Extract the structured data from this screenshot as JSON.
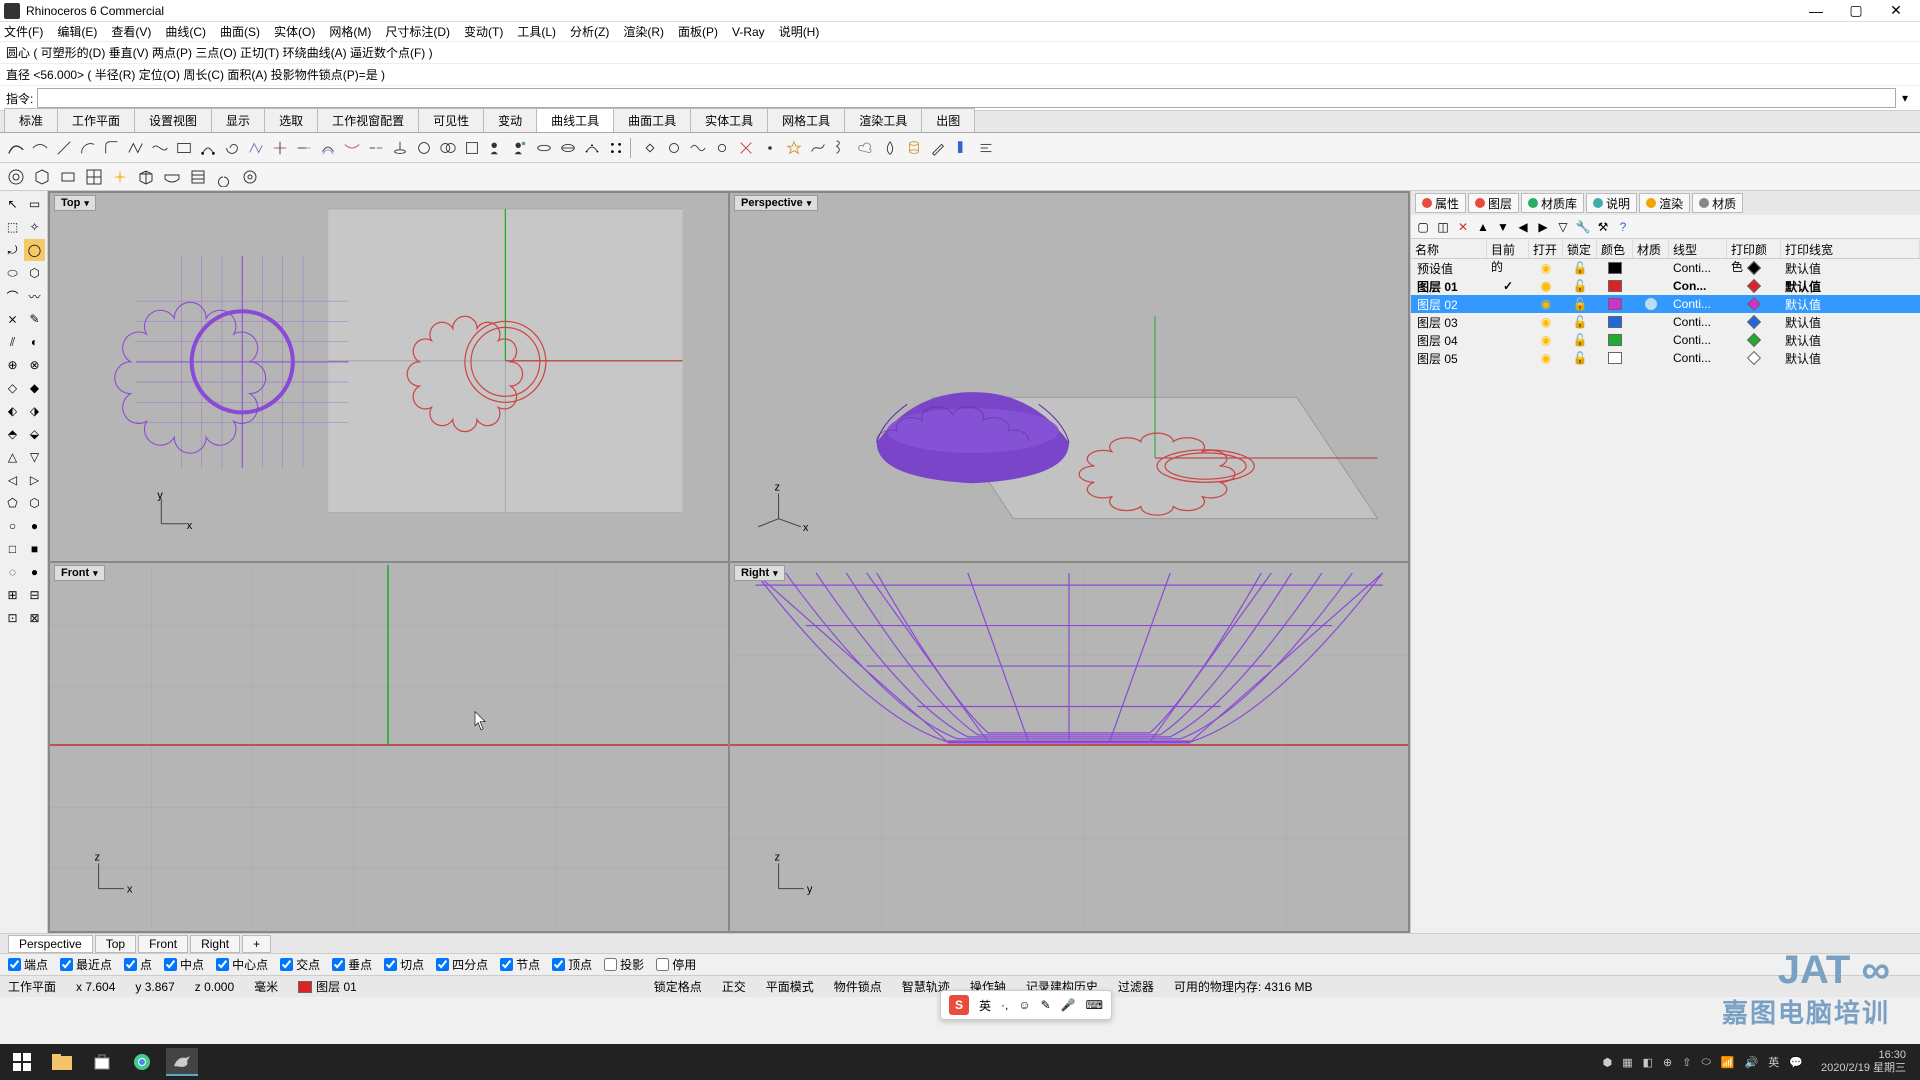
{
  "app": {
    "title": "Rhinoceros 6 Commercial"
  },
  "menu": [
    "文件(F)",
    "编辑(E)",
    "查看(V)",
    "曲线(C)",
    "曲面(S)",
    "实体(O)",
    "网格(M)",
    "尺寸标注(D)",
    "变动(T)",
    "工具(L)",
    "分析(Z)",
    "渲染(R)",
    "面板(P)",
    "V-Ray",
    "说明(H)"
  ],
  "cmd_history": [
    "圆心 ( 可塑形的(D)  垂直(V)  两点(P)  三点(O)  正切(T)  环绕曲线(A)  逼近数个点(F) )",
    "直径 <56.000> ( 半径(R)  定位(O)  周长(C)  面积(A)  投影物件锁点(P)=是 )"
  ],
  "cmd_prompt": "指令:",
  "ribbon_tabs": [
    "标准",
    "工作平面",
    "设置视图",
    "显示",
    "选取",
    "工作视窗配置",
    "可见性",
    "变动",
    "曲线工具",
    "曲面工具",
    "实体工具",
    "网格工具",
    "渲染工具",
    "出图"
  ],
  "active_ribbon_tab": 8,
  "viewports": {
    "top": "Top",
    "persp": "Perspective",
    "front": "Front",
    "right": "Right"
  },
  "bottom_vp_tabs": [
    "Perspective",
    "Top",
    "Front",
    "Right",
    "+"
  ],
  "osnaps": [
    {
      "label": "端点",
      "checked": true
    },
    {
      "label": "最近点",
      "checked": true
    },
    {
      "label": "点",
      "checked": true
    },
    {
      "label": "中点",
      "checked": true
    },
    {
      "label": "中心点",
      "checked": true
    },
    {
      "label": "交点",
      "checked": true
    },
    {
      "label": "垂点",
      "checked": true
    },
    {
      "label": "切点",
      "checked": true
    },
    {
      "label": "四分点",
      "checked": true
    },
    {
      "label": "节点",
      "checked": true
    },
    {
      "label": "顶点",
      "checked": true
    },
    {
      "label": "投影",
      "checked": false
    },
    {
      "label": "停用",
      "checked": false
    }
  ],
  "status": {
    "cplane": "工作平面",
    "x": "x 7.604",
    "y": "y 3.867",
    "z": "z 0.000",
    "unit": "毫米",
    "layer": "图层 01",
    "gridsnap": "锁定格点",
    "ortho": "正交",
    "planar": "平面模式",
    "osnap": "物件锁点",
    "smart": "智慧轨迹",
    "gumball": "操作轴",
    "history": "记录建构历史",
    "filter": "过滤器",
    "mem": "可用的物理内存: 4316 MB"
  },
  "right_panel": {
    "tabs": [
      "属性",
      "图层",
      "材质库",
      "说明",
      "渲染",
      "材质"
    ],
    "tab_colors": [
      "#e74c3c",
      "#e74c3c",
      "#27ae60",
      "#4aa",
      "#f4a300",
      "#888"
    ],
    "headers": {
      "name": "名称",
      "current": "目前的",
      "on": "打开",
      "lock": "锁定",
      "color": "颜色",
      "mat": "材质",
      "lt": "线型",
      "pc": "打印颜色",
      "pw": "打印线宽"
    },
    "layers": [
      {
        "name": "预设值",
        "current": false,
        "color": "#000000",
        "lt": "Conti...",
        "pc": "#000",
        "pw": "默认值"
      },
      {
        "name": "图层 01",
        "current": true,
        "color": "#d22",
        "lt": "Con...",
        "pc": "#d22",
        "pw": "默认值",
        "bold": true
      },
      {
        "name": "图层 02",
        "current": false,
        "color": "#c3c",
        "lt": "Conti...",
        "pc": "#c3c",
        "pw": "默认值",
        "sel": true,
        "mat": "#bde"
      },
      {
        "name": "图层 03",
        "current": false,
        "color": "#26d",
        "lt": "Conti...",
        "pc": "#26d",
        "pw": "默认值"
      },
      {
        "name": "图层 04",
        "current": false,
        "color": "#2a3",
        "lt": "Conti...",
        "pc": "#2a3",
        "pw": "默认值"
      },
      {
        "name": "图层 05",
        "current": false,
        "color": "#fff",
        "lt": "Conti...",
        "pc": "#fff",
        "pw": "默认值"
      }
    ]
  },
  "ime": {
    "lang": "英",
    "punct": "·,"
  },
  "clock": {
    "time": "16:30",
    "date": "2020/2/19 星期三"
  },
  "watermark": {
    "brand": "JAT",
    "sub": "嘉图电脑培训"
  }
}
